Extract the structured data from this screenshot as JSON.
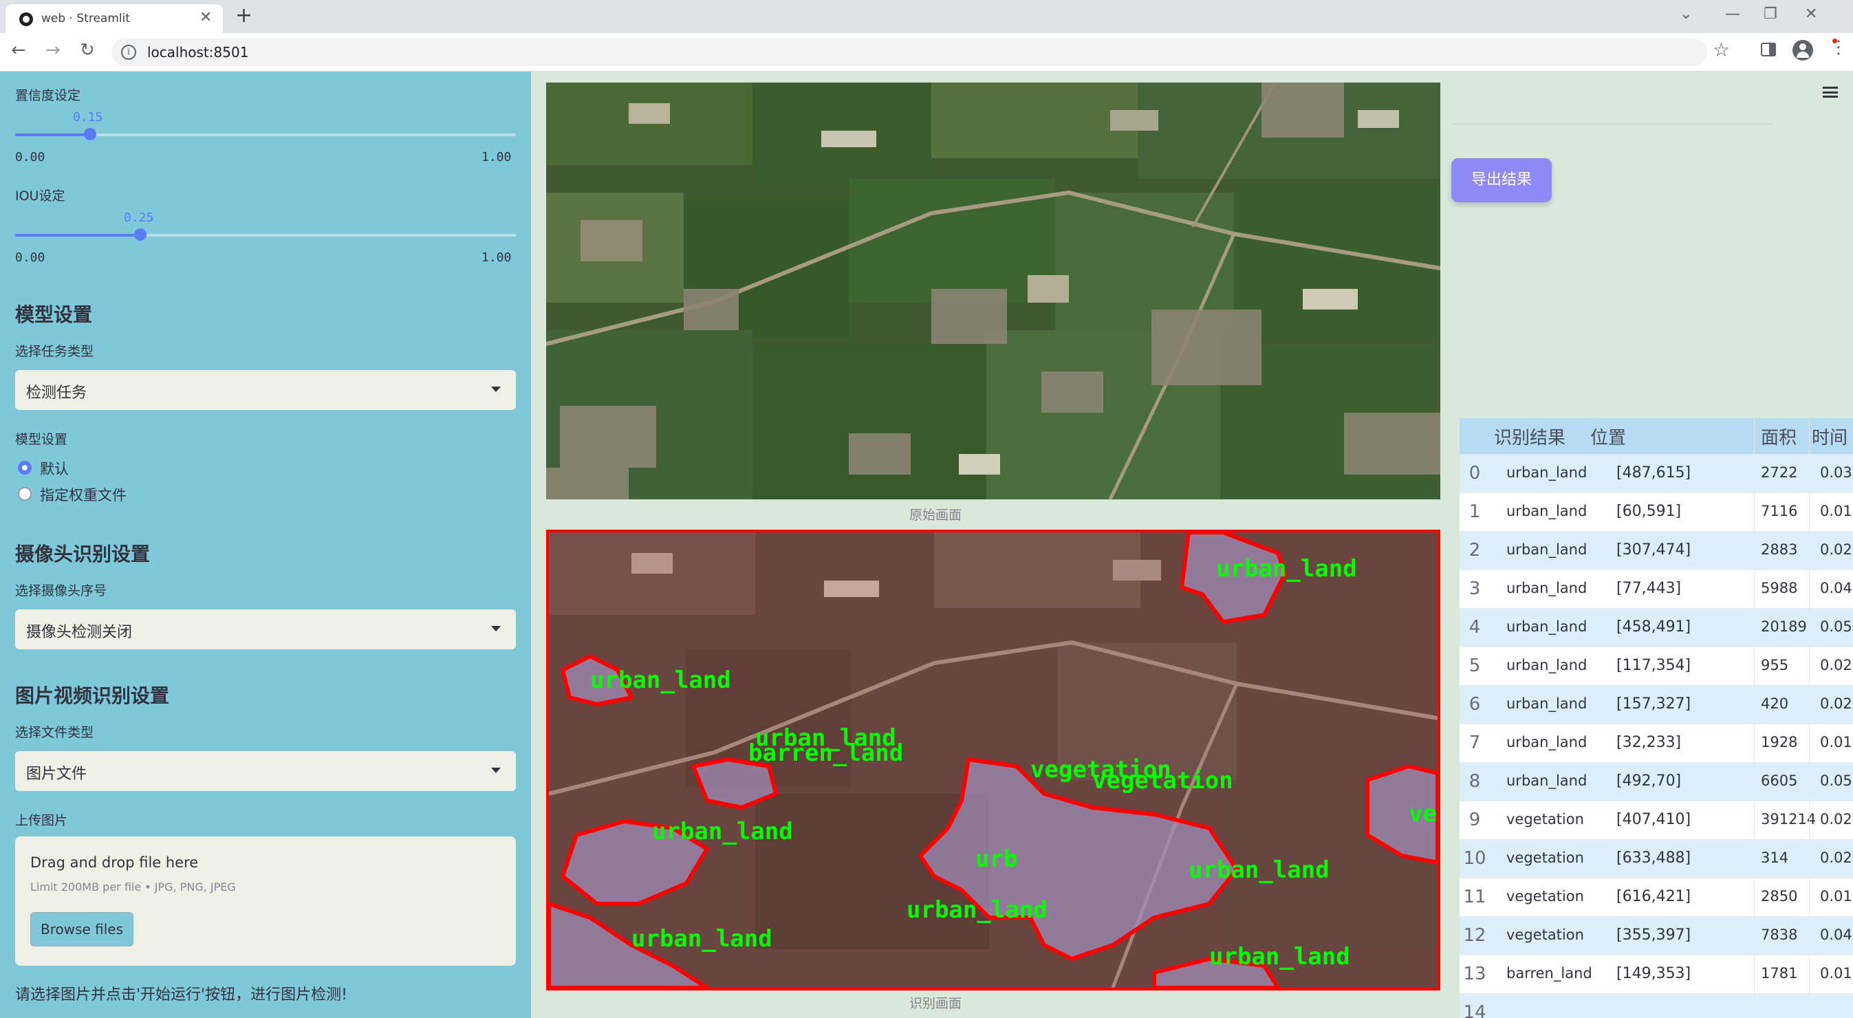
{
  "browser": {
    "tab_title": "web · Streamlit",
    "url": "localhost:8501"
  },
  "sidebar": {
    "confidence": {
      "label": "置信度设定",
      "value": "0.15",
      "min": "0.00",
      "max": "1.00",
      "fraction": 0.15
    },
    "iou": {
      "label": "IOU设定",
      "value": "0.25",
      "min": "0.00",
      "max": "1.00",
      "fraction": 0.25
    },
    "model_section": "模型设置",
    "task_type_label": "选择任务类型",
    "task_type_value": "检测任务",
    "model_setting_label": "模型设置",
    "radio_default": "默认",
    "radio_custom": "指定权重文件",
    "camera_section": "摄像头识别设置",
    "camera_label": "选择摄像头序号",
    "camera_value": "摄像头检测关闭",
    "media_section": "图片视频识别设置",
    "file_type_label": "选择文件类型",
    "file_type_value": "图片文件",
    "upload_label": "上传图片",
    "dropzone_title": "Drag and drop file here",
    "dropzone_sub": "Limit 200MB per file • JPG, PNG, JPEG",
    "browse_label": "Browse files",
    "hint": "请选择图片并点击'开始运行'按钮，进行图片检测!"
  },
  "main": {
    "caption_original": "原始画面",
    "caption_detected": "识别画面",
    "export_label": "导出结果",
    "detection_labels": [
      "urban_land",
      "urban_land",
      "urban_land",
      "barren_land",
      "vegetation",
      "vegetation",
      "urban_land",
      "urban_land",
      "urban_land",
      "urban_land",
      "urban_land",
      "ve",
      "urb"
    ]
  },
  "table": {
    "headers": [
      "识别结果",
      "位置",
      "面积",
      "时间"
    ],
    "rows": [
      {
        "idx": "0",
        "cls": "urban_land",
        "pos": "[487,615]",
        "area": "2722",
        "time": "0.03"
      },
      {
        "idx": "1",
        "cls": "urban_land",
        "pos": "[60,591]",
        "area": "7116",
        "time": "0.01"
      },
      {
        "idx": "2",
        "cls": "urban_land",
        "pos": "[307,474]",
        "area": "2883",
        "time": "0.02"
      },
      {
        "idx": "3",
        "cls": "urban_land",
        "pos": "[77,443]",
        "area": "5988",
        "time": "0.04"
      },
      {
        "idx": "4",
        "cls": "urban_land",
        "pos": "[458,491]",
        "area": "20189",
        "time": "0.05"
      },
      {
        "idx": "5",
        "cls": "urban_land",
        "pos": "[117,354]",
        "area": "955",
        "time": "0.02"
      },
      {
        "idx": "6",
        "cls": "urban_land",
        "pos": "[157,327]",
        "area": "420",
        "time": "0.02"
      },
      {
        "idx": "7",
        "cls": "urban_land",
        "pos": "[32,233]",
        "area": "1928",
        "time": "0.01"
      },
      {
        "idx": "8",
        "cls": "urban_land",
        "pos": "[492,70]",
        "area": "6605",
        "time": "0.05"
      },
      {
        "idx": "9",
        "cls": "vegetation",
        "pos": "[407,410]",
        "area": "391214",
        "time": "0.02"
      },
      {
        "idx": "10",
        "cls": "vegetation",
        "pos": "[633,488]",
        "area": "314",
        "time": "0.02"
      },
      {
        "idx": "11",
        "cls": "vegetation",
        "pos": "[616,421]",
        "area": "2850",
        "time": "0.01"
      },
      {
        "idx": "12",
        "cls": "vegetation",
        "pos": "[355,397]",
        "area": "7838",
        "time": "0.04"
      },
      {
        "idx": "13",
        "cls": "barren_land",
        "pos": "[149,353]",
        "area": "1781",
        "time": "0.01"
      },
      {
        "idx": "14",
        "cls": "",
        "pos": "",
        "area": "",
        "time": ""
      }
    ]
  },
  "colors": {
    "sidebar_bg": "#7ec8d9",
    "accent": "#5b7cfa",
    "export_btn": "#8f8af5",
    "detection_box": "#ff0000",
    "detection_label": "#00ff00",
    "table_header": "#b6dcf4"
  }
}
